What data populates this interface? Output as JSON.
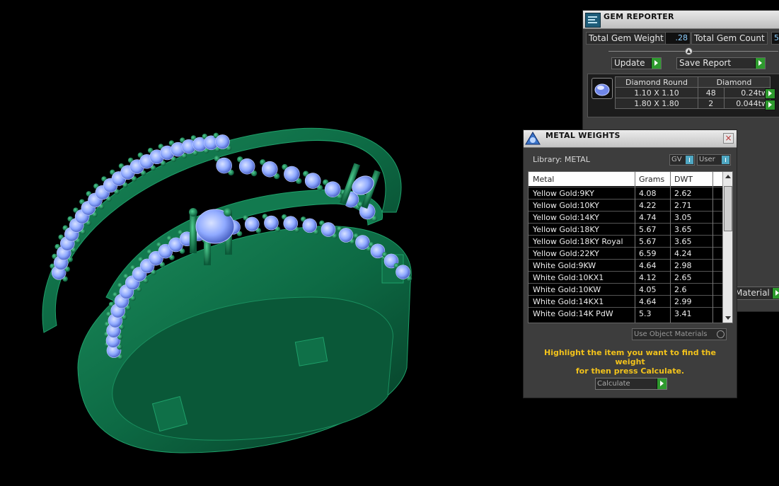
{
  "gem_reporter": {
    "title": "GEM REPORTER",
    "total_gem_weight_label": "Total Gem Weight",
    "total_gem_weight_value": ".28",
    "total_gem_count_label": "Total Gem Count",
    "total_gem_count_value": "5",
    "update_label": "Update",
    "save_report_label": "Save Report",
    "header_shape": "Diamond Round",
    "header_material": "Diamond",
    "rows": [
      {
        "size": "1.10 X 1.10",
        "count": "48",
        "weight": "0.24tw"
      },
      {
        "size": "1.80 X 1.80",
        "count": "2",
        "weight": "0.044tw"
      }
    ],
    "material_button_fragment": "Material"
  },
  "metal_weights": {
    "title": "METAL WEIGHTS",
    "library_label": "Library: METAL",
    "toggle_gv": "GV",
    "toggle_user": "User",
    "columns": {
      "metal": "Metal",
      "grams": "Grams",
      "dwt": "DWT"
    },
    "rows": [
      {
        "metal": "Yellow Gold:9KY",
        "grams": "4.08",
        "dwt": "2.62"
      },
      {
        "metal": "Yellow Gold:10KY",
        "grams": "4.22",
        "dwt": "2.71"
      },
      {
        "metal": "Yellow Gold:14KY",
        "grams": "4.74",
        "dwt": "3.05"
      },
      {
        "metal": "Yellow Gold:18KY",
        "grams": "5.67",
        "dwt": "3.65"
      },
      {
        "metal": "Yellow Gold:18KY Royal",
        "grams": "5.67",
        "dwt": "3.65"
      },
      {
        "metal": "Yellow Gold:22KY",
        "grams": "6.59",
        "dwt": "4.24"
      },
      {
        "metal": "White Gold:9KW",
        "grams": "4.64",
        "dwt": "2.98"
      },
      {
        "metal": "White Gold:10KX1",
        "grams": "4.12",
        "dwt": "2.65"
      },
      {
        "metal": "White Gold:10KW",
        "grams": "4.05",
        "dwt": "2.6"
      },
      {
        "metal": "White Gold:14KX1",
        "grams": "4.64",
        "dwt": "2.99"
      },
      {
        "metal": "White Gold:14K PdW",
        "grams": "5.3",
        "dwt": "3.41"
      }
    ],
    "use_object_materials_label": "Use Object Materials",
    "hint_line1": "Highlight the item you want to find the weight",
    "hint_line2": "for then press Calculate.",
    "calculate_label": "Calculate"
  },
  "colors": {
    "ring_metal": "#0e6b45",
    "gem_blue": "#8fa9ff",
    "accent_green": "#2e9a2e",
    "hint_yellow": "#f2c21b"
  }
}
